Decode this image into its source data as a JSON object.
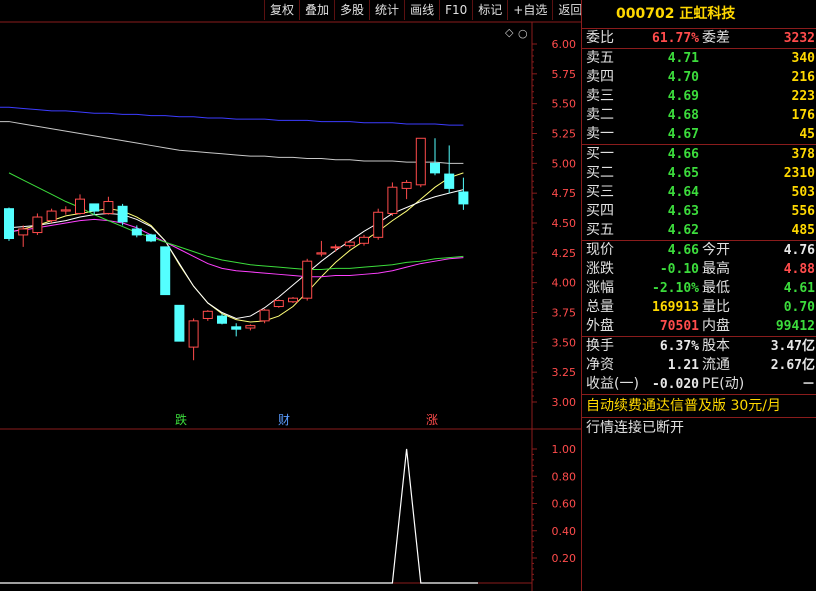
{
  "toolbar": [
    "复权",
    "叠加",
    "多股",
    "统计",
    "画线",
    "F10",
    "标记",
    "+自选",
    "返回"
  ],
  "price_axis": [
    "6.00",
    "5.75",
    "5.50",
    "5.25",
    "5.00",
    "4.75",
    "4.50",
    "4.25",
    "4.00",
    "3.75",
    "3.50",
    "3.25",
    "3.00"
  ],
  "indicator_axis": [
    "1.00",
    "0.80",
    "0.60",
    "0.40",
    "0.20"
  ],
  "markers": [
    {
      "text": "跌",
      "color": "#3cdc3c"
    },
    {
      "text": "财",
      "color": "#5a9cff"
    },
    {
      "text": "涨",
      "color": "#ff4c4c"
    }
  ],
  "chart_data": {
    "type": "candlestick",
    "ylim": [
      3.0,
      6.0
    ],
    "candles": [
      {
        "o": 4.62,
        "h": 4.63,
        "l": 4.35,
        "c": 4.37
      },
      {
        "o": 4.4,
        "h": 4.48,
        "l": 4.3,
        "c": 4.45
      },
      {
        "o": 4.42,
        "h": 4.58,
        "l": 4.4,
        "c": 4.55
      },
      {
        "o": 4.52,
        "h": 4.62,
        "l": 4.5,
        "c": 4.6
      },
      {
        "o": 4.6,
        "h": 4.64,
        "l": 4.57,
        "c": 4.61
      },
      {
        "o": 4.58,
        "h": 4.74,
        "l": 4.57,
        "c": 4.7
      },
      {
        "o": 4.66,
        "h": 4.66,
        "l": 4.57,
        "c": 4.6
      },
      {
        "o": 4.58,
        "h": 4.72,
        "l": 4.57,
        "c": 4.68
      },
      {
        "o": 4.64,
        "h": 4.66,
        "l": 4.48,
        "c": 4.51
      },
      {
        "o": 4.45,
        "h": 4.48,
        "l": 4.38,
        "c": 4.4
      },
      {
        "o": 4.4,
        "h": 4.41,
        "l": 4.34,
        "c": 4.35
      },
      {
        "o": 4.3,
        "h": 4.3,
        "l": 3.9,
        "c": 3.9
      },
      {
        "o": 3.81,
        "h": 3.81,
        "l": 3.51,
        "c": 3.51
      },
      {
        "o": 3.46,
        "h": 3.7,
        "l": 3.35,
        "c": 3.68
      },
      {
        "o": 3.7,
        "h": 3.77,
        "l": 3.68,
        "c": 3.76
      },
      {
        "o": 3.72,
        "h": 3.74,
        "l": 3.65,
        "c": 3.66
      },
      {
        "o": 3.63,
        "h": 3.66,
        "l": 3.55,
        "c": 3.61
      },
      {
        "o": 3.62,
        "h": 3.65,
        "l": 3.6,
        "c": 3.64
      },
      {
        "o": 3.68,
        "h": 3.78,
        "l": 3.66,
        "c": 3.77
      },
      {
        "o": 3.8,
        "h": 3.86,
        "l": 3.79,
        "c": 3.85
      },
      {
        "o": 3.84,
        "h": 3.88,
        "l": 3.83,
        "c": 3.87
      },
      {
        "o": 3.87,
        "h": 4.2,
        "l": 3.85,
        "c": 4.18
      },
      {
        "o": 4.24,
        "h": 4.35,
        "l": 4.22,
        "c": 4.25
      },
      {
        "o": 4.3,
        "h": 4.32,
        "l": 4.26,
        "c": 4.3
      },
      {
        "o": 4.31,
        "h": 4.35,
        "l": 4.29,
        "c": 4.34
      },
      {
        "o": 4.33,
        "h": 4.4,
        "l": 4.31,
        "c": 4.38
      },
      {
        "o": 4.38,
        "h": 4.62,
        "l": 4.36,
        "c": 4.59
      },
      {
        "o": 4.58,
        "h": 4.84,
        "l": 4.56,
        "c": 4.8
      },
      {
        "o": 4.79,
        "h": 4.86,
        "l": 4.7,
        "c": 4.84
      },
      {
        "o": 4.82,
        "h": 5.21,
        "l": 4.8,
        "c": 5.21
      },
      {
        "o": 5.0,
        "h": 5.21,
        "l": 4.9,
        "c": 4.92
      },
      {
        "o": 4.91,
        "h": 5.15,
        "l": 4.75,
        "c": 4.79
      },
      {
        "o": 4.76,
        "h": 4.88,
        "l": 4.61,
        "c": 4.66
      }
    ],
    "ma_lines": [
      {
        "name": "MA5",
        "color": "#ffff78",
        "points": [
          4.42,
          4.45,
          4.48,
          4.52,
          4.56,
          4.58,
          4.6,
          4.62,
          4.6,
          4.55,
          4.48,
          4.35,
          4.15,
          3.97,
          3.83,
          3.74,
          3.69,
          3.67,
          3.68,
          3.72,
          3.8,
          3.92,
          4.05,
          4.17,
          4.27,
          4.35,
          4.43,
          4.52,
          4.6,
          4.7,
          4.8,
          4.88,
          4.92
        ]
      },
      {
        "name": "MA10",
        "color": "#ffffff",
        "points": [
          4.46,
          4.47,
          4.48,
          4.5,
          4.52,
          4.55,
          4.57,
          4.58,
          4.57,
          4.53,
          4.47,
          4.35,
          4.16,
          3.97,
          3.83,
          3.75,
          3.7,
          3.72,
          3.79,
          3.88,
          3.98,
          4.08,
          4.18,
          4.27,
          4.35,
          4.43,
          4.5,
          4.58,
          4.63,
          4.68,
          4.72,
          4.75,
          4.78
        ]
      },
      {
        "name": "MA20",
        "color": "#ff40ff",
        "points": [
          4.43,
          4.44,
          4.46,
          4.48,
          4.5,
          4.52,
          4.53,
          4.52,
          4.5,
          4.46,
          4.4,
          4.34,
          4.28,
          4.22,
          4.16,
          4.12,
          4.1,
          4.09,
          4.08,
          4.07,
          4.06,
          4.05,
          4.05,
          4.06,
          4.06,
          4.07,
          4.08,
          4.1,
          4.13,
          4.16,
          4.18,
          4.2,
          4.21
        ]
      },
      {
        "name": "MA60",
        "color": "#3cdc3c",
        "points": [
          4.92,
          4.86,
          4.8,
          4.74,
          4.68,
          4.63,
          4.57,
          4.52,
          4.47,
          4.42,
          4.38,
          4.34,
          4.3,
          4.26,
          4.22,
          4.19,
          4.17,
          4.15,
          4.14,
          4.13,
          4.12,
          4.11,
          4.11,
          4.12,
          4.12,
          4.13,
          4.14,
          4.15,
          4.17,
          4.18,
          4.2,
          4.21,
          4.22
        ]
      },
      {
        "name": "MA120",
        "color": "#c8c8c8",
        "points": [
          5.35,
          5.33,
          5.31,
          5.29,
          5.27,
          5.25,
          5.23,
          5.21,
          5.19,
          5.17,
          5.15,
          5.13,
          5.11,
          5.1,
          5.09,
          5.08,
          5.07,
          5.06,
          5.06,
          5.05,
          5.05,
          5.04,
          5.04,
          5.03,
          5.03,
          5.02,
          5.02,
          5.02,
          5.01,
          5.01,
          5.01,
          5.0,
          5.0
        ]
      },
      {
        "name": "MA250",
        "color": "#3c3cff",
        "points": [
          5.47,
          5.46,
          5.45,
          5.44,
          5.44,
          5.43,
          5.42,
          5.42,
          5.41,
          5.41,
          5.4,
          5.4,
          5.39,
          5.39,
          5.38,
          5.38,
          5.37,
          5.37,
          5.37,
          5.36,
          5.36,
          5.36,
          5.35,
          5.35,
          5.35,
          5.34,
          5.34,
          5.34,
          5.33,
          5.33,
          5.33,
          5.32,
          5.32
        ]
      }
    ],
    "indicator": {
      "ylim": [
        0,
        1.1
      ],
      "values": [
        0,
        0,
        0,
        0,
        0,
        0,
        0,
        0,
        0,
        0,
        0,
        0,
        0,
        0,
        0,
        0,
        0,
        0,
        0,
        0,
        0,
        0,
        0,
        0,
        0,
        0,
        0,
        0,
        1,
        0,
        0,
        0,
        0
      ]
    }
  },
  "panel": {
    "title": "000702 正虹科技",
    "weibi": {
      "l1": "委比",
      "v1": "61.77%",
      "l2": "委差",
      "v2": "3232"
    },
    "asks": [
      {
        "l": "卖五",
        "p": "4.71",
        "v": "340"
      },
      {
        "l": "卖四",
        "p": "4.70",
        "v": "216"
      },
      {
        "l": "卖三",
        "p": "4.69",
        "v": "223"
      },
      {
        "l": "卖二",
        "p": "4.68",
        "v": "176"
      },
      {
        "l": "卖一",
        "p": "4.67",
        "v": "45"
      }
    ],
    "bids": [
      {
        "l": "买一",
        "p": "4.66",
        "v": "378"
      },
      {
        "l": "买二",
        "p": "4.65",
        "v": "2310"
      },
      {
        "l": "买三",
        "p": "4.64",
        "v": "503"
      },
      {
        "l": "买四",
        "p": "4.63",
        "v": "556"
      },
      {
        "l": "买五",
        "p": "4.62",
        "v": "485"
      }
    ],
    "stats1": [
      {
        "l1": "现价",
        "v1": "4.66",
        "c1": "green",
        "l2": "今开",
        "v2": "4.76",
        "c2": "white"
      },
      {
        "l1": "涨跌",
        "v1": "-0.10",
        "c1": "green",
        "l2": "最高",
        "v2": "4.88",
        "c2": "red"
      },
      {
        "l1": "涨幅",
        "v1": "-2.10%",
        "c1": "green",
        "l2": "最低",
        "v2": "4.61",
        "c2": "green"
      },
      {
        "l1": "总量",
        "v1": "169913",
        "c1": "yellow",
        "l2": "量比",
        "v2": "0.70",
        "c2": "green"
      },
      {
        "l1": "外盘",
        "v1": "70501",
        "c1": "red",
        "l2": "内盘",
        "v2": "99412",
        "c2": "green"
      }
    ],
    "stats2": [
      {
        "l1": "换手",
        "v1": "6.37%",
        "c1": "white",
        "l2": "股本",
        "v2": "3.47亿",
        "c2": "white"
      },
      {
        "l1": "净资",
        "v1": "1.21",
        "c1": "white",
        "l2": "流通",
        "v2": "2.67亿",
        "c2": "white"
      },
      {
        "l1": "收益(一)",
        "v1": "-0.020",
        "c1": "white",
        "l2": "PE(动)",
        "v2": "－",
        "c2": "white"
      }
    ],
    "ad": "自动续费通达信普及版  30元/月",
    "status": "行情连接已断开"
  },
  "colors": {
    "up": "#ff4c4c",
    "down": "#54ffff",
    "grid": "#8a1c1c",
    "axis_text": "#ff4c4c"
  }
}
